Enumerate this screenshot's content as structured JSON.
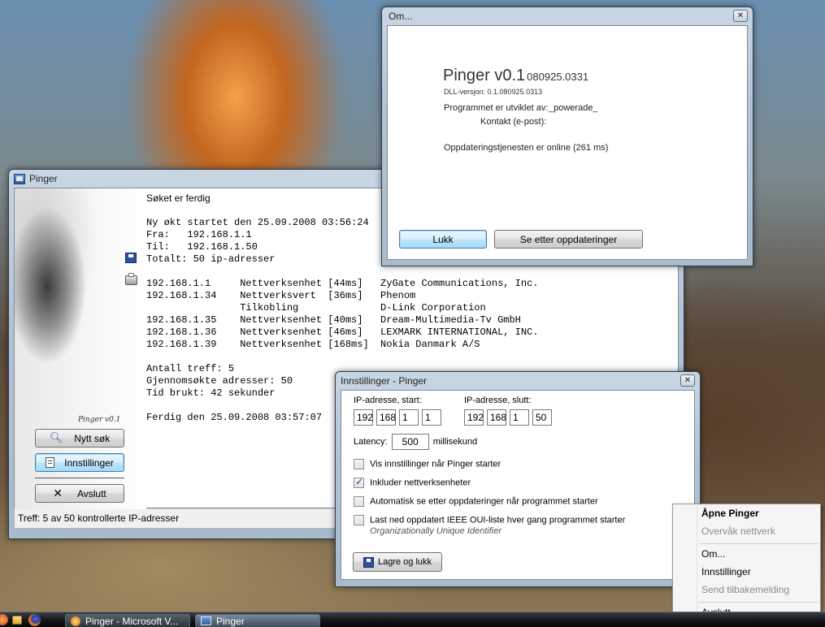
{
  "pinger_window": {
    "title": "Pinger",
    "status_done": "Søket er ferdig",
    "log_header_lines": [
      "Ny økt startet den 25.09.2008 03:56:24",
      "Fra:   192.168.1.1",
      "Til:   192.168.1.50",
      "Totalt: 50 ip-adresser"
    ],
    "results": [
      "192.168.1.1     Nettverksenhet [44ms]   ZyGate Communications, Inc.",
      "192.168.1.34    Nettverksvert  [36ms]   Phenom",
      "                Tilkobling              D-Link Corporation",
      "192.168.1.35    Nettverksenhet [40ms]   Dream-Multimedia-Tv GmbH",
      "192.168.1.36    Nettverksenhet [46ms]   LEXMARK INTERNATIONAL, INC.",
      "192.168.1.39    Nettverksenhet [168ms]  Nokia Danmark A/S"
    ],
    "summary_lines": [
      "Antall treff: 5",
      "Gjennomsøkte adresser: 50",
      "Tid brukt: 42 sekunder"
    ],
    "finished_line": "Ferdig den 25.09.2008 03:57:07",
    "version_label": "Pinger v0.1",
    "buttons": {
      "new_search": "Nytt søk",
      "settings": "Innstillinger",
      "exit": "Avslutt"
    },
    "statusbar": "Treff: 5 av 50 kontrollerte IP-adresser"
  },
  "about_window": {
    "title": "Om...",
    "app_name": "Pinger v0.1",
    "build": "080925.0331",
    "dll_version": "DLL-versjon: 0.1.080925.0313",
    "developer_label": "Programmet er utviklet av:",
    "developer_value": "_powerade_",
    "contact_label": "Kontakt (e-post):",
    "update_status": "Oppdateringstjenesten er online (261 ms)",
    "close_button": "Lukk",
    "check_updates_button": "Se etter oppdateringer"
  },
  "settings_window": {
    "title": "Innstillinger - Pinger",
    "ip_start_label": "IP-adresse, start:",
    "ip_end_label": "IP-adresse, slutt:",
    "ip_start": [
      "192",
      "168",
      "1",
      "1"
    ],
    "ip_end": [
      "192",
      "168",
      "1",
      "50"
    ],
    "latency_label": "Latency:",
    "latency_value": "500",
    "latency_unit": "millisekund",
    "options": [
      {
        "label": "Vis innstillinger når Pinger starter",
        "checked": false
      },
      {
        "label": "Inkluder nettverksenheter",
        "checked": true
      },
      {
        "label": "Automatisk se etter oppdateringer når programmet starter",
        "checked": false
      },
      {
        "label": "Last ned oppdatert IEEE OUI-liste hver gang programmet starter",
        "checked": false
      }
    ],
    "oui_note": "Organizationally Unique Identifier",
    "save_button": "Lagre og lukk"
  },
  "context_menu": {
    "open": "Åpne Pinger",
    "monitor": "Overvåk nettverk",
    "about": "Om...",
    "settings": "Innstillinger",
    "feedback": "Send tilbakemelding",
    "exit": "Avslutt"
  },
  "taskbar": {
    "task1": "Pinger - Microsoft V...",
    "task2": "Pinger"
  },
  "colors": {
    "accent": "#3c7fb1",
    "disabled_text": "#8a8a8a"
  }
}
